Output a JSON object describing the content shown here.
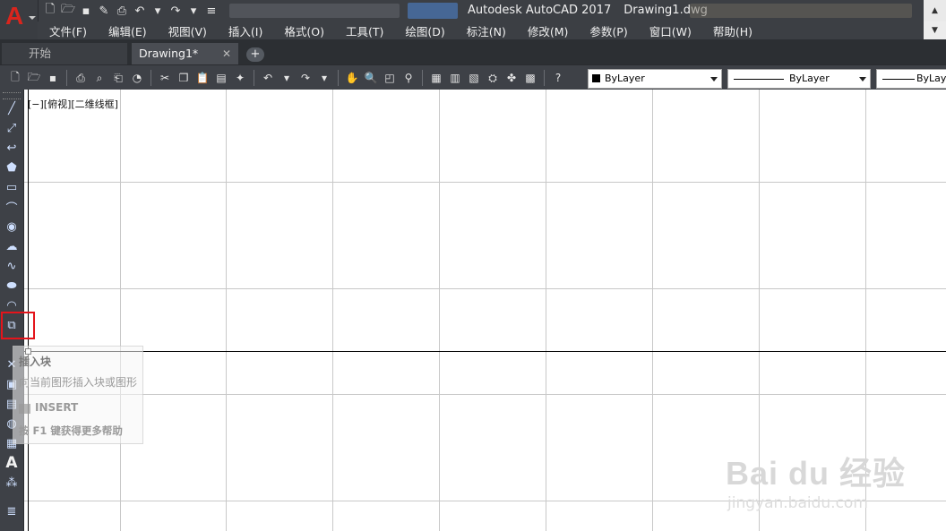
{
  "window": {
    "title_app": "Autodesk AutoCAD 2017",
    "title_file": "Drawing1.dwg",
    "app_logo": "A",
    "quick_access_icons": [
      "new-icon",
      "open-icon",
      "save-icon",
      "save-as-icon",
      "print-icon",
      "undo-icon",
      "redo-icon",
      "customize-icon"
    ]
  },
  "menu": {
    "items": [
      "文件(F)",
      "编辑(E)",
      "视图(V)",
      "插入(I)",
      "格式(O)",
      "工具(T)",
      "绘图(D)",
      "标注(N)",
      "修改(M)",
      "参数(P)",
      "窗口(W)",
      "帮助(H)"
    ]
  },
  "tabs": {
    "start": "开始",
    "active": "Drawing1*",
    "close_glyph": "✕",
    "add_glyph": "+"
  },
  "toolbar": {
    "icons": [
      "new-icon",
      "open-icon",
      "save-icon",
      "print-icon",
      "plot-preview-icon",
      "publish-icon",
      "3d-print-icon",
      "cut-icon",
      "copy-icon",
      "paste-icon",
      "match-properties-icon",
      "block-editor-icon",
      "undo-icon",
      "redo-icon",
      "pan-icon",
      "zoom-realtime-icon",
      "zoom-window-icon",
      "zoom-previous-icon",
      "properties-icon",
      "design-center-icon",
      "tool-palettes-icon",
      "sheet-set-icon",
      "markup-icon",
      "quickcalc-icon",
      "help-icon"
    ],
    "color_value": "ByLayer",
    "linetype_value": "ByLayer",
    "lineweight_value": "ByLayer"
  },
  "left_toolbar": {
    "icons": [
      "line-icon",
      "construction-line-icon",
      "polyline-icon",
      "polygon-icon",
      "rectangle-icon",
      "arc-icon",
      "circle-icon",
      "revision-cloud-icon",
      "spline-icon",
      "ellipse-icon",
      "ellipse-arc-icon",
      "insert-block-icon",
      "make-block-icon",
      "point-icon",
      "hatch-icon",
      "gradient-icon",
      "region-icon",
      "table-icon",
      "multiline-text-icon",
      "add-selected-icon"
    ],
    "text_icon_glyph": "A"
  },
  "canvas": {
    "viewport_label": "[−][俯视][二维线框]",
    "background": "#ffffff",
    "grid_color": "#c8c8c8",
    "axis_color": "#000000"
  },
  "tooltip": {
    "title": "插入块",
    "description": "向当前图形插入块或图形",
    "command": "INSERT",
    "help": "按 F1 键获得更多帮助"
  },
  "watermark": {
    "main": "Bai du 经验",
    "sub": "jingyan.baidu.com"
  },
  "colors": {
    "titlebar": "#3c3f44",
    "highlight": "#e4141b",
    "logo": "#d9251d"
  }
}
